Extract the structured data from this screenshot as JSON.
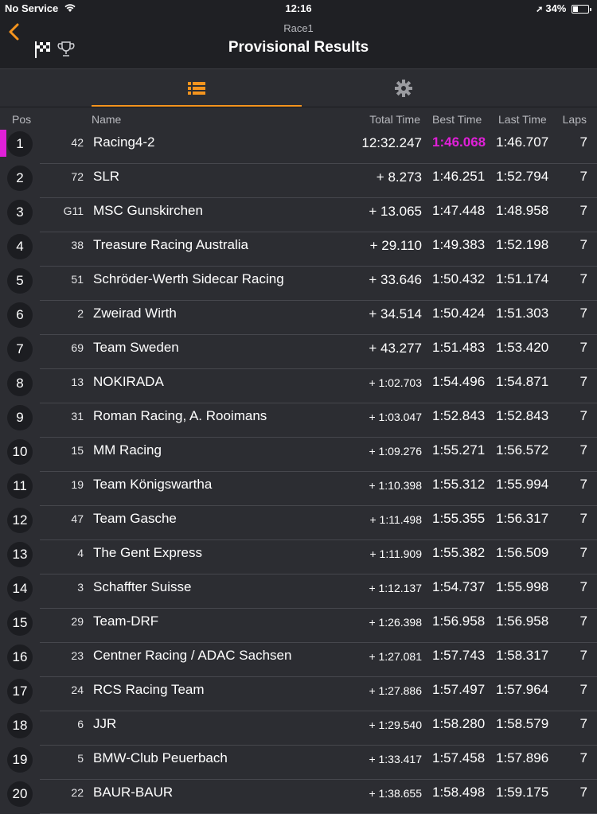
{
  "status_bar": {
    "carrier": "No Service",
    "time": "12:16",
    "battery": "34%",
    "battery_level": 0.34
  },
  "nav": {
    "subtitle": "Race1",
    "title": "Provisional Results"
  },
  "colors": {
    "accent": "#f4941e",
    "fastest": "#e020d8",
    "background": "#2c2d32"
  },
  "tabs": [
    {
      "icon": "list-icon",
      "active": true
    },
    {
      "icon": "gear-icon",
      "active": false
    }
  ],
  "columns": {
    "pos": "Pos",
    "name": "Name",
    "total": "Total Time",
    "best": "Best Time",
    "last": "Last Time",
    "laps": "Laps"
  },
  "rows": [
    {
      "pos": "1",
      "num": "42",
      "name": "Racing4-2",
      "total": "12:32.247",
      "best": "1:46.068",
      "last": "1:46.707",
      "laps": "7",
      "fastest": true
    },
    {
      "pos": "2",
      "num": "72",
      "name": "SLR",
      "total": "+ 8.273",
      "best": "1:46.251",
      "last": "1:52.794",
      "laps": "7"
    },
    {
      "pos": "3",
      "num": "G11",
      "name": "MSC Gunskirchen",
      "total": "+ 13.065",
      "best": "1:47.448",
      "last": "1:48.958",
      "laps": "7"
    },
    {
      "pos": "4",
      "num": "38",
      "name": "Treasure Racing Australia",
      "total": "+ 29.110",
      "best": "1:49.383",
      "last": "1:52.198",
      "laps": "7"
    },
    {
      "pos": "5",
      "num": "51",
      "name": "Schröder-Werth Sidecar Racing",
      "total": "+ 33.646",
      "best": "1:50.432",
      "last": "1:51.174",
      "laps": "7"
    },
    {
      "pos": "6",
      "num": "2",
      "name": "Zweirad Wirth",
      "total": "+ 34.514",
      "best": "1:50.424",
      "last": "1:51.303",
      "laps": "7"
    },
    {
      "pos": "7",
      "num": "69",
      "name": "Team Sweden",
      "total": "+ 43.277",
      "best": "1:51.483",
      "last": "1:53.420",
      "laps": "7"
    },
    {
      "pos": "8",
      "num": "13",
      "name": "NOKIRADA",
      "total": "+ 1:02.703",
      "best": "1:54.496",
      "last": "1:54.871",
      "laps": "7"
    },
    {
      "pos": "9",
      "num": "31",
      "name": "Roman Racing, A. Rooimans",
      "total": "+ 1:03.047",
      "best": "1:52.843",
      "last": "1:52.843",
      "laps": "7"
    },
    {
      "pos": "10",
      "num": "15",
      "name": "MM Racing",
      "total": "+ 1:09.276",
      "best": "1:55.271",
      "last": "1:56.572",
      "laps": "7"
    },
    {
      "pos": "11",
      "num": "19",
      "name": "Team Königswartha",
      "total": "+ 1:10.398",
      "best": "1:55.312",
      "last": "1:55.994",
      "laps": "7"
    },
    {
      "pos": "12",
      "num": "47",
      "name": "Team Gasche",
      "total": "+ 1:11.498",
      "best": "1:55.355",
      "last": "1:56.317",
      "laps": "7"
    },
    {
      "pos": "13",
      "num": "4",
      "name": "The Gent Express",
      "total": "+ 1:11.909",
      "best": "1:55.382",
      "last": "1:56.509",
      "laps": "7"
    },
    {
      "pos": "14",
      "num": "3",
      "name": "Schaffter Suisse",
      "total": "+ 1:12.137",
      "best": "1:54.737",
      "last": "1:55.998",
      "laps": "7"
    },
    {
      "pos": "15",
      "num": "29",
      "name": "Team-DRF",
      "total": "+ 1:26.398",
      "best": "1:56.958",
      "last": "1:56.958",
      "laps": "7"
    },
    {
      "pos": "16",
      "num": "23",
      "name": "Centner Racing / ADAC Sachsen",
      "total": "+ 1:27.081",
      "best": "1:57.743",
      "last": "1:58.317",
      "laps": "7"
    },
    {
      "pos": "17",
      "num": "24",
      "name": "RCS Racing Team",
      "total": "+ 1:27.886",
      "best": "1:57.497",
      "last": "1:57.964",
      "laps": "7"
    },
    {
      "pos": "18",
      "num": "6",
      "name": "JJR",
      "total": "+ 1:29.540",
      "best": "1:58.280",
      "last": "1:58.579",
      "laps": "7"
    },
    {
      "pos": "19",
      "num": "5",
      "name": "BMW-Club Peuerbach",
      "total": "+ 1:33.417",
      "best": "1:57.458",
      "last": "1:57.896",
      "laps": "7"
    },
    {
      "pos": "20",
      "num": "22",
      "name": "BAUR-BAUR",
      "total": "+ 1:38.655",
      "best": "1:58.498",
      "last": "1:59.175",
      "laps": "7"
    }
  ]
}
